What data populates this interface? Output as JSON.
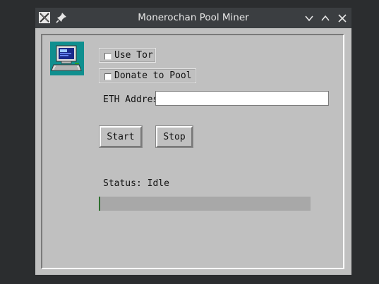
{
  "window": {
    "title": "Monerochan Pool Miner"
  },
  "options": {
    "use_tor_label": "Use Tor",
    "use_tor_checked": false,
    "donate_label": "Donate to Pool",
    "donate_checked": false
  },
  "eth_address": {
    "label": "ETH Address",
    "value": ""
  },
  "buttons": {
    "start": "Start",
    "stop": "Stop"
  },
  "status": {
    "text": "Status: Idle"
  },
  "progress": {
    "fraction": 0.0
  },
  "icons": {
    "window_app": "x-logo-icon",
    "pin": "pin-icon",
    "minimize": "chevron-down-icon",
    "maximize": "chevron-up-icon",
    "close": "close-icon",
    "app": "computer-icon"
  },
  "colors": {
    "titlebar": "#3b3e41",
    "client_bg": "#c0c0c0",
    "icon_bg": "#0f8f8f",
    "progress_track": "#a8a8a8",
    "progress_fill": "#2f6f2f"
  }
}
